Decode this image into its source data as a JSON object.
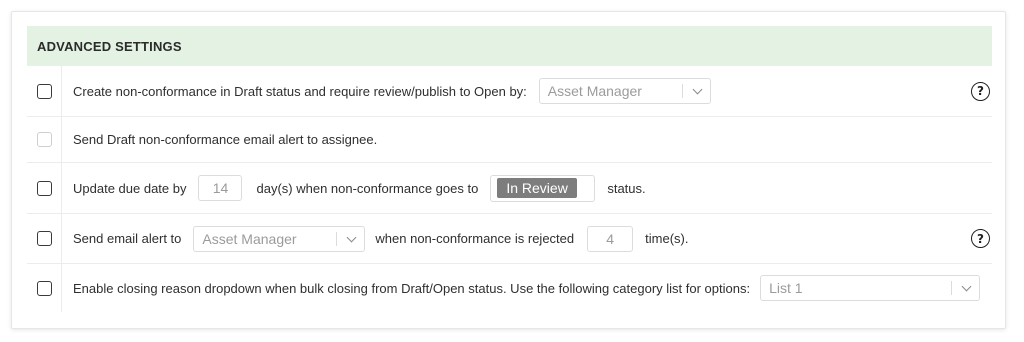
{
  "header": {
    "title": "ADVANCED SETTINGS"
  },
  "rows": [
    {
      "checked": false,
      "text_before": "Create non-conformance in Draft status and require review/publish to Open by:",
      "dropdown_value": "Asset Manager",
      "help_icon": "question-circle-icon"
    },
    {
      "checked": false,
      "disabled": true,
      "text": "Send Draft non-conformance email alert to assignee."
    },
    {
      "checked": false,
      "text_before": "Update due date by",
      "days_value": "14",
      "text_middle": "day(s) when non-conformance goes to",
      "status_tag": "In Review",
      "text_after": "status."
    },
    {
      "checked": false,
      "text_before": "Send email alert to",
      "dropdown_value": "Asset Manager",
      "text_middle": "when non-conformance is rejected",
      "times_value": "4",
      "text_after": "time(s).",
      "help_icon": "question-circle-icon"
    },
    {
      "checked": false,
      "text_before": "Enable closing reason dropdown when bulk closing from Draft/Open status. Use the following category list for options:",
      "dropdown_value": "List 1"
    }
  ],
  "colors": {
    "header_bg": "#e3f2e3",
    "status_tag_bg": "#7d7d7d"
  }
}
